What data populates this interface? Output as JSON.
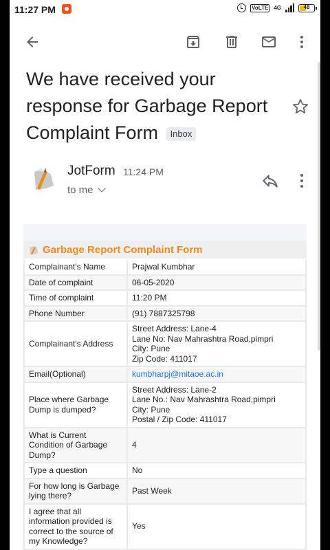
{
  "status_bar": {
    "time": "11:27 PM",
    "network_badge_1": "4G",
    "network_badge_2": "VoLTE",
    "battery": "48"
  },
  "toolbar": {
    "back_icon": "arrow-left-icon",
    "archive_icon": "archive-icon",
    "delete_icon": "trash-icon",
    "unread_icon": "mail-icon",
    "more_icon": "more-vert-icon"
  },
  "email": {
    "subject": "We have received your response for Garbage Report Complaint Form",
    "label_chip": "Inbox",
    "sender": "JotForm",
    "time": "11:24 PM",
    "recipient": "to me"
  },
  "form": {
    "title": "Garbage Report Complaint Form",
    "rows": [
      {
        "label": "Complainant's Name",
        "value": [
          "Prajwal Kumbhar"
        ]
      },
      {
        "label": "Date of complaint",
        "value": [
          "06-05-2020"
        ]
      },
      {
        "label": "Time of complaint",
        "value": [
          "11:20 PM"
        ]
      },
      {
        "label": "Phone Number",
        "value": [
          "(91) 7887325798"
        ]
      },
      {
        "label": "Complainant's Address",
        "value": [
          "Street Address: Lane-4",
          "Lane No: Nav Mahrashtra Road,pimpri",
          "City: Pune",
          "Zip Code: 411017"
        ]
      },
      {
        "label": "Email(Optional)",
        "value": [
          "kumbharpj@mitaoe.ac.in"
        ],
        "link": true
      },
      {
        "label": "Place where Garbage Dump is dumped?",
        "value": [
          "Street Address: Lane-2",
          "Lane No.: Nav Mahrashtra Road,pimpri",
          "City: Pune",
          "Postal / Zip Code: 411017"
        ]
      },
      {
        "label": "What is Current Condition of Garbage Dump?",
        "value": [
          "4"
        ]
      },
      {
        "label": "Type a question",
        "value": [
          "No"
        ]
      },
      {
        "label": "For how long is Garbage lying there?",
        "value": [
          "Past Week"
        ]
      },
      {
        "label": "I agree that all information provided is correct to the source of my Knowledge?",
        "value": [
          "Yes"
        ]
      }
    ]
  },
  "colors": {
    "form_title": "#f28a1b",
    "link": "#1a73e8"
  }
}
